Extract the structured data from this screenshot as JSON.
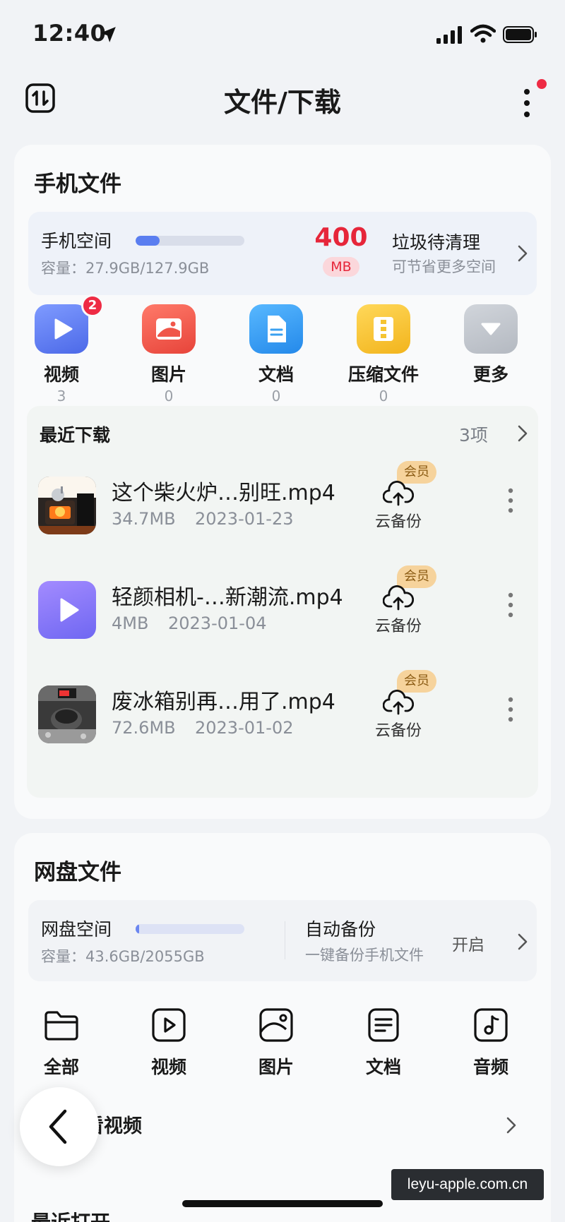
{
  "status_bar": {
    "time": "12:40"
  },
  "nav": {
    "title": "文件/下载"
  },
  "phone_files": {
    "title": "手机文件",
    "space": {
      "label": "手机空间",
      "capacity": "容量：27.9GB/127.9GB",
      "used_fraction": 0.218
    },
    "junk": {
      "value": "400",
      "unit": "MB",
      "title": "垃圾待清理",
      "subtitle": "可节省更多空间"
    },
    "categories": [
      {
        "label": "视频",
        "count": "3",
        "badge": "2",
        "icon": "video-icon",
        "color": "#5b7cf0"
      },
      {
        "label": "图片",
        "count": "0",
        "icon": "image-icon",
        "color": "#f0564a"
      },
      {
        "label": "文档",
        "count": "0",
        "icon": "document-icon",
        "color": "#3aa0f0"
      },
      {
        "label": "压缩文件",
        "count": "0",
        "icon": "zip-icon",
        "color": "#f5c431"
      },
      {
        "label": "更多",
        "count": "",
        "icon": "more-icon",
        "color": "#c2c7ce"
      }
    ],
    "recent": {
      "title": "最近下载",
      "count": "3项",
      "items": [
        {
          "name": "这个柴火炉…别旺.mp4",
          "size": "34.7MB",
          "date": "2023-01-23",
          "cloud": "云备份",
          "vip": "会员",
          "thumb": "stove-video-thumbnail"
        },
        {
          "name": "轻颜相机-…新潮流.mp4",
          "size": "4MB",
          "date": "2023-01-04",
          "cloud": "云备份",
          "vip": "会员",
          "thumb": "video-play-icon"
        },
        {
          "name": "废冰箱别再…用了.mp4",
          "size": "72.6MB",
          "date": "2023-01-02",
          "cloud": "云备份",
          "vip": "会员",
          "thumb": "fridge-video-thumbnail"
        }
      ]
    }
  },
  "cloud_files": {
    "title": "网盘文件",
    "space": {
      "label": "网盘空间",
      "capacity": "容量：43.6GB/2055GB",
      "used_fraction": 0.021
    },
    "auto_backup": {
      "title": "自动备份",
      "subtitle": "一键备份手机文件",
      "action": "开启"
    },
    "categories": [
      {
        "label": "全部",
        "icon": "folder-icon"
      },
      {
        "label": "视频",
        "icon": "video-outline-icon"
      },
      {
        "label": "图片",
        "icon": "image-outline-icon"
      },
      {
        "label": "文档",
        "icon": "document-outline-icon"
      },
      {
        "label": "音频",
        "icon": "music-icon"
      }
    ],
    "watch": {
      "label": "看视频"
    }
  },
  "recent_open": {
    "title": "最近打开"
  },
  "watermark": {
    "text": "leyu-apple.com.cn"
  }
}
